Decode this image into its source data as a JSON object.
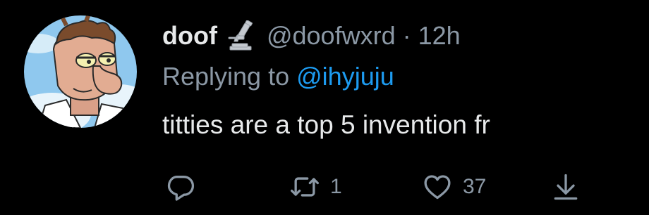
{
  "tweet": {
    "display_name": "doof",
    "name_emoji": "microscope-icon",
    "handle": "@doofwxrd",
    "separator": "·",
    "timestamp": "12h",
    "reply_prefix": "Replying to",
    "reply_handle": "@ihyjuju",
    "text": "titties are a top 5 invention fr"
  },
  "actions": {
    "reply_icon": "reply-icon",
    "retweet_icon": "retweet-icon",
    "retweet_count": "1",
    "like_icon": "heart-icon",
    "like_count": "37",
    "share_icon": "share-icon"
  },
  "colors": {
    "background": "#000000",
    "primary_text": "#e7e9ea",
    "secondary_text": "#8b98a5",
    "link": "#1d9bf0"
  }
}
